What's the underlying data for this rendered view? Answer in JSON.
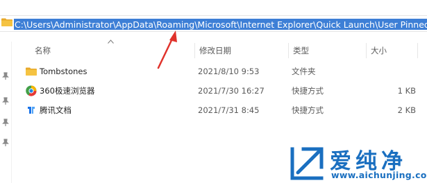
{
  "address_bar": {
    "path": "C:\\Users\\Administrator\\AppData\\Roaming\\Microsoft\\Internet Explorer\\Quick Launch\\User Pinned\\TaskBar"
  },
  "columns": {
    "name": "名称",
    "modified": "修改日期",
    "type": "类型",
    "size": "大小"
  },
  "rows": [
    {
      "name": "Tombstones",
      "modified": "2021/8/10 9:53",
      "type": "文件夹",
      "size": "",
      "icon": "folder-icon"
    },
    {
      "name": "360极速浏览器",
      "modified": "2021/7/30 16:27",
      "type": "快捷方式",
      "size": "1 KB",
      "icon": "360-browser-icon"
    },
    {
      "name": "腾讯文档",
      "modified": "2021/7/31 8:45",
      "type": "快捷方式",
      "size": "2 KB",
      "icon": "tencent-docs-icon"
    }
  ],
  "watermark": {
    "brand": "爱纯净",
    "url": "www.aichunjing.com"
  },
  "colors": {
    "selection": "#3d7fd6",
    "arrow": "#e0322b",
    "watermark": "#1a6fc0",
    "folder": "#f5c342"
  }
}
